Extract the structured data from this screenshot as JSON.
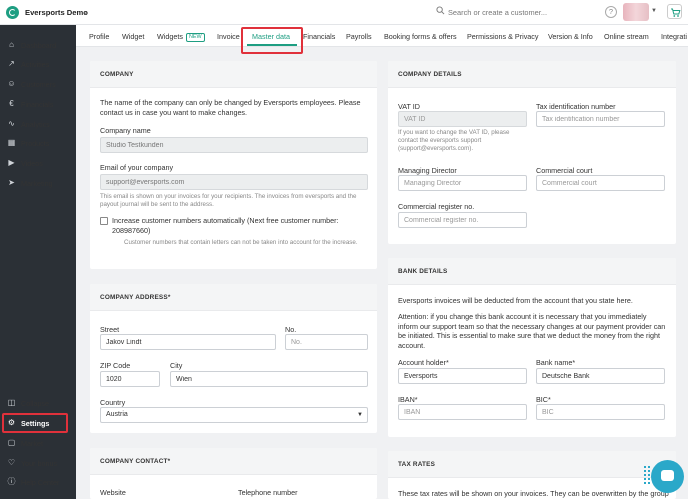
{
  "header": {
    "org_name": "Eversports Demo",
    "search_placeholder": "Search or create a customer...",
    "help_icon": "?"
  },
  "sidebar": {
    "items": [
      {
        "label": "Dashboard",
        "icon": "dashboard-icon"
      },
      {
        "label": "Activities",
        "icon": "activities-icon"
      },
      {
        "label": "Customers",
        "icon": "customers-icon"
      },
      {
        "label": "Financials",
        "icon": "euro-icon"
      },
      {
        "label": "Analytics",
        "icon": "analytics-icon"
      },
      {
        "label": "Products",
        "icon": "products-icon"
      },
      {
        "label": "Videos",
        "icon": "videos-icon"
      },
      {
        "label": "Marketing",
        "icon": "marketing-icon"
      }
    ],
    "bottom_items": [
      {
        "label": "Collapse",
        "icon": "collapse-icon"
      },
      {
        "label": "Settings",
        "icon": "gear-icon"
      },
      {
        "label": "Market",
        "icon": "market-icon"
      },
      {
        "label": "Your bonus",
        "icon": "heart-icon"
      },
      {
        "label": "Help Center",
        "icon": "help-icon"
      }
    ],
    "active": "Settings"
  },
  "tabs": {
    "items": [
      "Profile",
      "Widget",
      "Widgets",
      "Invoice",
      "Master data",
      "Financials",
      "Payrolls",
      "Booking forms & offers",
      "Permissions & Privacy",
      "Version & Info",
      "Online stream",
      "Integrati"
    ],
    "new_badge": "NEW",
    "active": "Master data"
  },
  "company": {
    "title": "COMPANY",
    "intro": "The name of the company can only be changed by Eversports employees. Please contact us in case you want to make changes.",
    "name_label": "Company name",
    "name_value": "Studio Testkunden",
    "email_label": "Email of your company",
    "email_value": "support@eversports.com",
    "email_hint": "This email is shown on your invoices for your recipients. The invoices from eversports and the payout journal will be sent to the address.",
    "increase_label": "Increase customer numbers automatically (Next free customer number: 208987660)",
    "increase_hint": "Customer numbers that contain letters can not be taken into account for the increase."
  },
  "address": {
    "title": "COMPANY ADDRESS*",
    "street_label": "Street",
    "street_value": "Jakov Lindt",
    "no_label": "No.",
    "no_placeholder": "No.",
    "zip_label": "ZIP Code",
    "zip_value": "1020",
    "city_label": "City",
    "city_value": "Wien",
    "country_label": "Country",
    "country_value": "Austria"
  },
  "contact": {
    "title": "COMPANY CONTACT*",
    "website_label": "Website",
    "phone_label": "Telephone number"
  },
  "details": {
    "title": "COMPANY DETAILS",
    "vat_label": "VAT ID",
    "vat_placeholder": "VAT ID",
    "vat_hint": "If you want to change the VAT ID, please contact the eversports support (support@eversports.com).",
    "tax_label": "Tax identification number",
    "tax_placeholder": "Tax identification number",
    "director_label": "Managing Director",
    "director_placeholder": "Managing Director",
    "court_label": "Commercial court",
    "court_placeholder": "Commercial court",
    "register_label": "Commercial register no.",
    "register_placeholder": "Commercial register no."
  },
  "bank": {
    "title": "BANK DETAILS",
    "intro": "Eversports invoices will be deducted from the account that you state here.",
    "attention": "Attention:  if you change this bank account it is necessary that you immediately inform our support team so that the necessary changes at our payment provider can be initiated. This is essential to make sure that we deduct the money from the right account.",
    "holder_label": "Account holder*",
    "holder_value": "Eversports",
    "bank_label": "Bank name*",
    "bank_value": "Deutsche Bank",
    "iban_label": "IBAN*",
    "iban_placeholder": "IBAN",
    "bic_label": "BIC*",
    "bic_placeholder": "BIC"
  },
  "tax": {
    "title": "TAX RATES",
    "intro": "These tax rates will be shown on your invoices. They can be overwritten by the group"
  }
}
